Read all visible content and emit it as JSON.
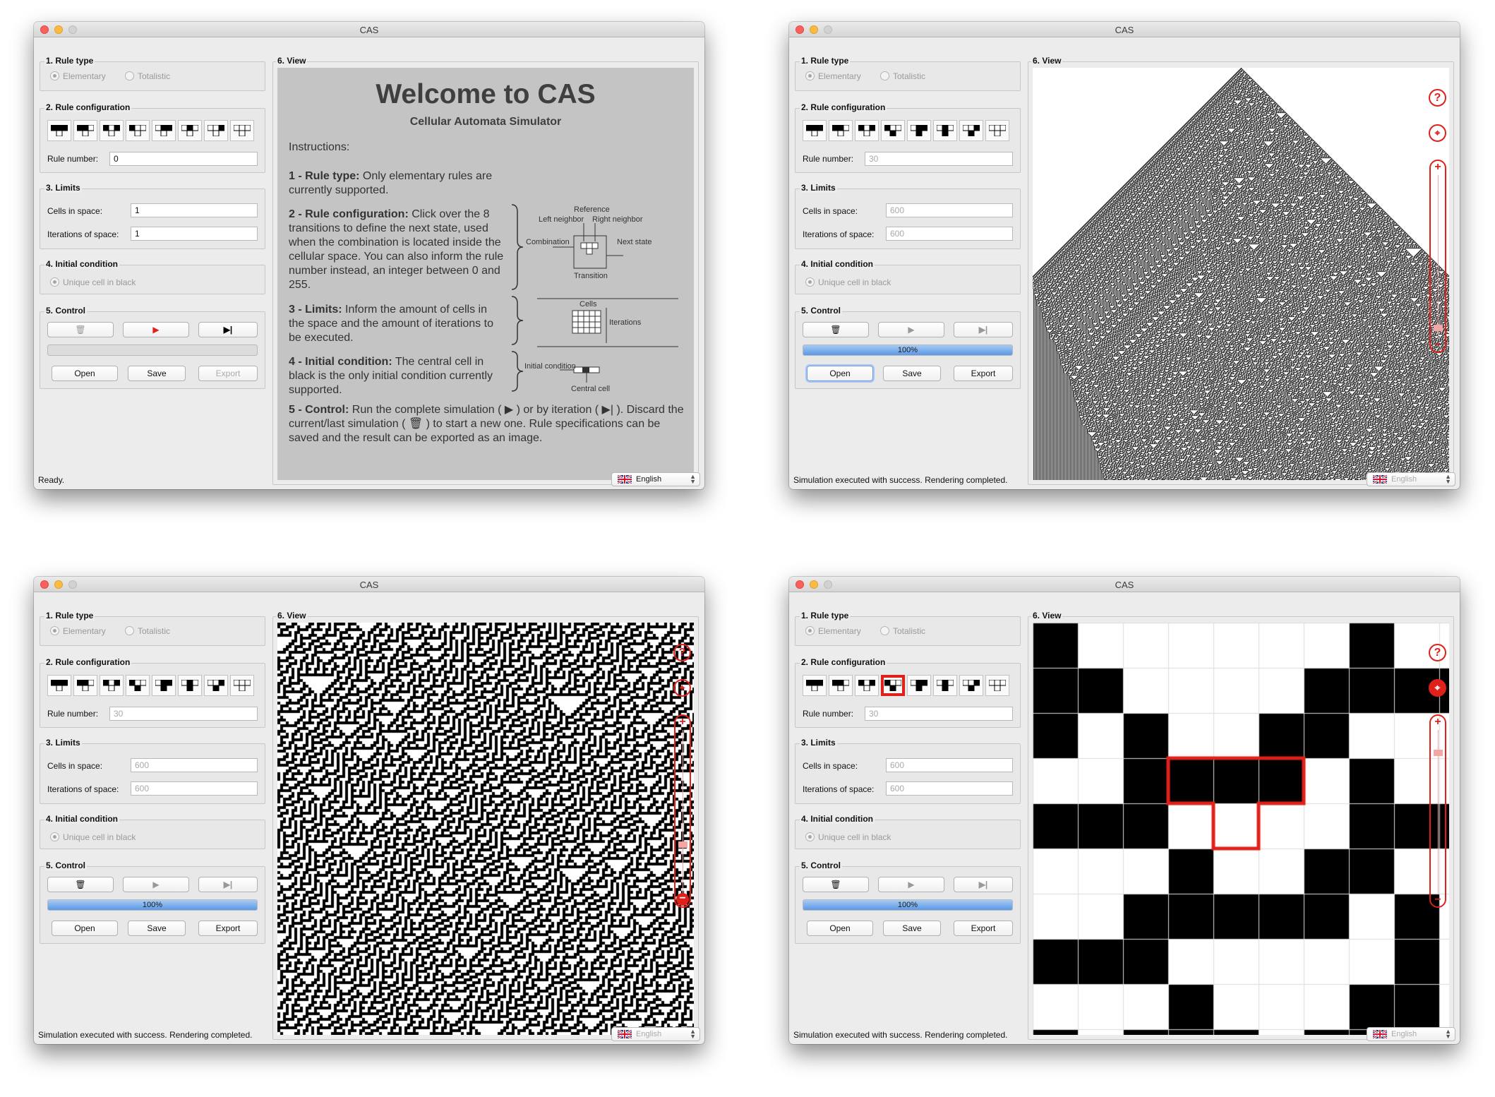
{
  "app": {
    "title": "CAS"
  },
  "labels": {
    "rule_type": "1. Rule type",
    "elementary": "Elementary",
    "totalistic": "Totalistic",
    "rule_config": "2. Rule configuration",
    "rule_number": "Rule number:",
    "limits": "3. Limits",
    "cells_space": "Cells in space:",
    "iterations_space": "Iterations of space:",
    "initial_condition": "4. Initial condition",
    "unique_cell": "Unique cell in black",
    "control": "5. Control",
    "open": "Open",
    "save": "Save",
    "export": "Export",
    "view": "6. View",
    "language": "English"
  },
  "windows": [
    {
      "rule_number": "0",
      "cells": "1",
      "iterations": "1",
      "progress": null,
      "status": "Ready."
    },
    {
      "rule_number": "30",
      "cells": "600",
      "iterations": "600",
      "progress": "100%",
      "status": "Simulation executed with success. Rendering completed."
    },
    {
      "rule_number": "30",
      "cells": "600",
      "iterations": "600",
      "progress": "100%",
      "status": "Simulation executed with success. Rendering completed."
    },
    {
      "rule_number": "30",
      "cells": "600",
      "iterations": "600",
      "progress": "100%",
      "status": "Simulation executed with success. Rendering completed."
    }
  ],
  "welcome": {
    "title": "Welcome to CAS",
    "subtitle": "Cellular Automata Simulator",
    "instructions": "Instructions:",
    "s1_bold": "1 - Rule type:",
    "s1_text": " Only elementary rules are currently supported.",
    "s2_bold": "2 - Rule configuration:",
    "s2_text": " Click over the 8 transitions to define the next state, used when the combination is located inside the cellular space. You can also inform the rule number instead, an integer between 0 and 255.",
    "s3_bold": "3 - Limits:",
    "s3_text": " Inform the amount of cells in the space and the amount of iterations to be executed.",
    "s4_bold": "4 - Initial condition:",
    "s4_text": " The central cell in black is the only initial condition currently supported.",
    "s5_bold": "5 - Control:",
    "s5_text": " Run the complete simulation ( ▶ ) or by iteration ( ▶| ). Discard the current/last simulation ( 🗑 ) to start a new one. Rule specifications can be saved and the result can be exported as an image.",
    "diagram": {
      "reference": "Reference",
      "left_neighbor": "Left neighbor",
      "right_neighbor": "Right neighbor",
      "combination": "Combination",
      "next_state": "Next state",
      "transition": "Transition",
      "cells": "Cells",
      "iterations": "Iterations",
      "initial_condition": "Initial condition",
      "central_cell": "Central cell"
    }
  },
  "zoom_controls": {
    "help_icon": "?"
  },
  "colors": {
    "accent_red": "#e0201a",
    "progress_blue": "#5b98e6",
    "welcome_bg": "#c4c4c4"
  }
}
